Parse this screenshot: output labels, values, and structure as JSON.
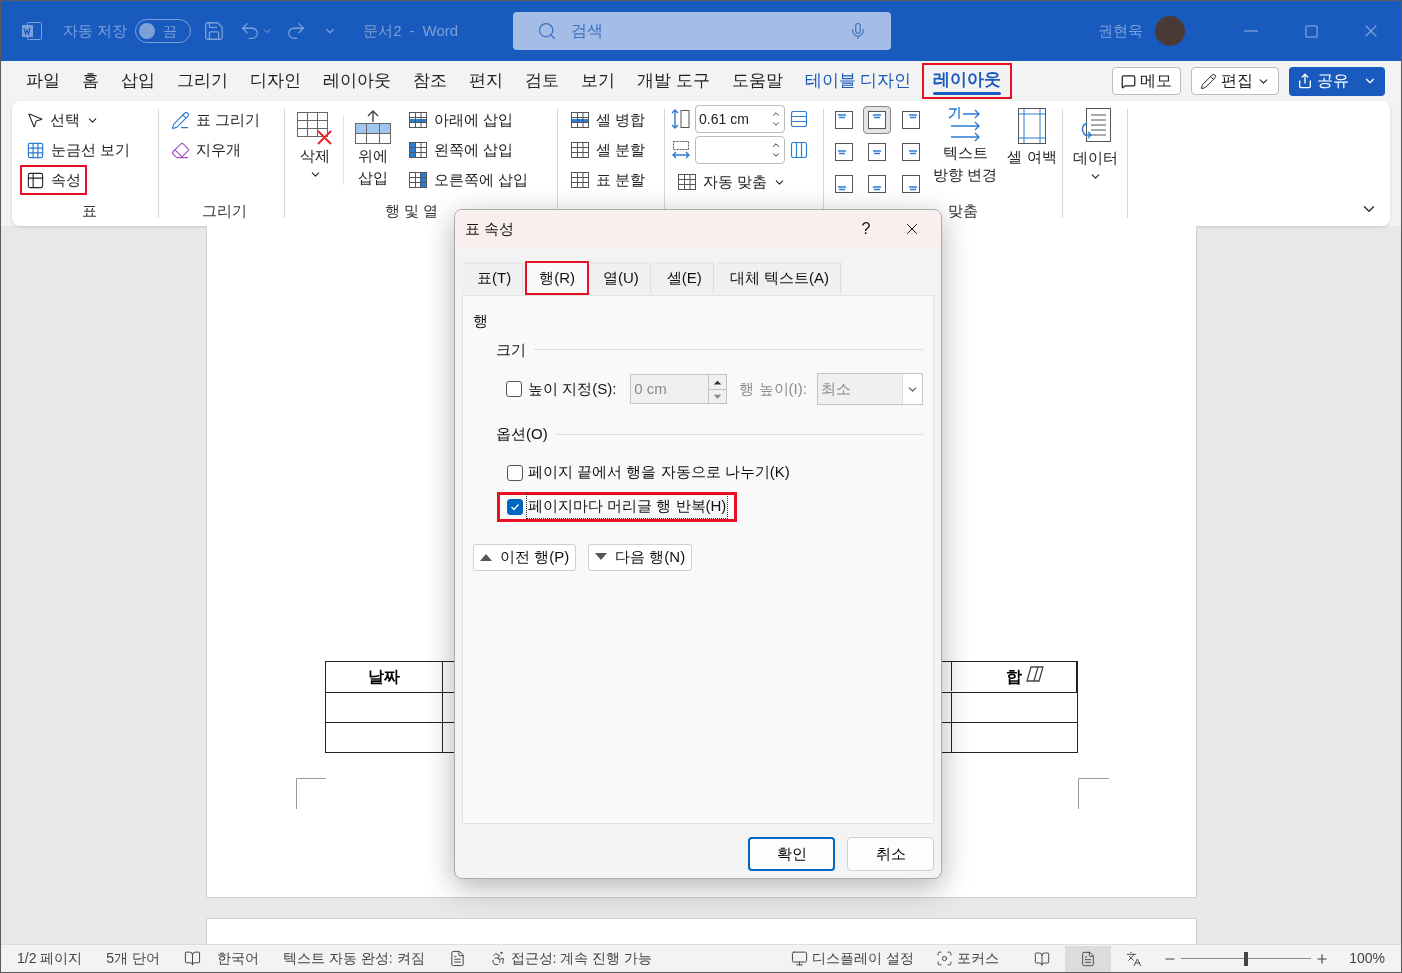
{
  "title_bar": {
    "autosave": {
      "label": "자동 저장",
      "state": "끔",
      "on": false
    },
    "document": "문서2",
    "separator": "-",
    "app": "Word",
    "search_placeholder": "검색",
    "user": "권현욱"
  },
  "ribbon_tabs": [
    {
      "label": "파일",
      "selected": false,
      "contextual": false,
      "highlighted": false
    },
    {
      "label": "홈",
      "selected": false,
      "contextual": false,
      "highlighted": false
    },
    {
      "label": "삽입",
      "selected": false,
      "contextual": false,
      "highlighted": false
    },
    {
      "label": "그리기",
      "selected": false,
      "contextual": false,
      "highlighted": false
    },
    {
      "label": "디자인",
      "selected": false,
      "contextual": false,
      "highlighted": false
    },
    {
      "label": "레이아웃",
      "selected": false,
      "contextual": false,
      "highlighted": false
    },
    {
      "label": "참조",
      "selected": false,
      "contextual": false,
      "highlighted": false
    },
    {
      "label": "편지",
      "selected": false,
      "contextual": false,
      "highlighted": false
    },
    {
      "label": "검토",
      "selected": false,
      "contextual": false,
      "highlighted": false
    },
    {
      "label": "보기",
      "selected": false,
      "contextual": false,
      "highlighted": false
    },
    {
      "label": "개발 도구",
      "selected": false,
      "contextual": false,
      "highlighted": false
    },
    {
      "label": "도움말",
      "selected": false,
      "contextual": false,
      "highlighted": false
    },
    {
      "label": "테이블 디자인",
      "selected": false,
      "contextual": true,
      "highlighted": false
    },
    {
      "label": "레이아웃",
      "selected": true,
      "contextual": true,
      "highlighted": true
    }
  ],
  "actions": {
    "comment": "메모",
    "editing": "편집",
    "share": "공유"
  },
  "ribbon": {
    "table_group": {
      "label": "표",
      "items": [
        {
          "label": "선택",
          "dropdown": true,
          "highlighted": false
        },
        {
          "label": "눈금선 보기",
          "dropdown": false,
          "highlighted": false
        },
        {
          "label": "속성",
          "dropdown": false,
          "highlighted": true
        }
      ]
    },
    "draw_group": {
      "label": "그리기",
      "items": [
        "표 그리기",
        "지우개"
      ]
    },
    "rows_columns_group": {
      "label": "행 및 열",
      "delete": "삭제",
      "insert_above": [
        "위에",
        "삽입"
      ],
      "items": [
        "아래에 삽입",
        "왼쪽에 삽입",
        "오른쪽에 삽입"
      ]
    },
    "merge_group": {
      "items": [
        "셀 병합",
        "셀 분할",
        "표 분할"
      ]
    },
    "cell_size_group": {
      "height": "0.61 cm",
      "autofit": "자동 맞춤"
    },
    "alignment_group": {
      "label": "맞춤",
      "buttons": [
        {
          "selected": false
        },
        {
          "selected": true
        },
        {
          "selected": false
        },
        {
          "selected": false
        },
        {
          "selected": false
        },
        {
          "selected": false
        },
        {
          "selected": false
        },
        {
          "selected": false
        },
        {
          "selected": false
        }
      ],
      "text_direction": [
        "텍스트",
        "방향 변경"
      ],
      "cell_margins": "셀 여백"
    },
    "data_group": {
      "label": "데이터"
    }
  },
  "document": {
    "table": {
      "columns": [
        {
          "kind": "text",
          "heading": "날짜"
        },
        {
          "kind": "blank"
        },
        {
          "kind": "text",
          "heading": "합"
        }
      ]
    }
  },
  "dialog": {
    "title": "표 속성",
    "help": "?",
    "tabs": [
      {
        "label": "표(T)",
        "selected": false,
        "highlighted": false
      },
      {
        "label": "행(R)",
        "selected": true,
        "highlighted": true
      },
      {
        "label": "열(U)",
        "selected": false,
        "highlighted": false
      },
      {
        "label": "셀(E)",
        "selected": false,
        "highlighted": false
      },
      {
        "label": "대체 텍스트(A)",
        "selected": false,
        "highlighted": false
      }
    ],
    "section": "행",
    "size_heading": "크기",
    "specify_height": {
      "label": "높이 지정(S):",
      "checked": false
    },
    "height_field": {
      "value": "0 cm",
      "disabled": true
    },
    "row_height_label": "행 높이(I):",
    "row_height_select": {
      "value": "최소",
      "disabled": true
    },
    "options_heading": "옵션(O)",
    "options": [
      {
        "label": "페이지 끝에서 행을 자동으로 나누기(K)",
        "checked": false,
        "highlighted": false
      },
      {
        "label": "페이지마다 머리글 행 반복(H)",
        "checked": true,
        "highlighted": true
      }
    ],
    "previous_row": "이전 행(P)",
    "next_row": "다음 행(N)",
    "ok": "확인",
    "cancel": "취소"
  },
  "status_bar": {
    "page": "1/2 페이지",
    "words": "5개 단어",
    "language": "한국어",
    "autocomplete": "텍스트 자동 완성: 켜짐",
    "accessibility": "접근성: 계속 진행 가능",
    "display": "디스플레이 설정",
    "focus": "포커스",
    "views": [
      {
        "selected": false
      },
      {
        "selected": true
      },
      {
        "selected": false
      }
    ],
    "zoom": {
      "level": 0.5,
      "reading": "100%"
    }
  }
}
